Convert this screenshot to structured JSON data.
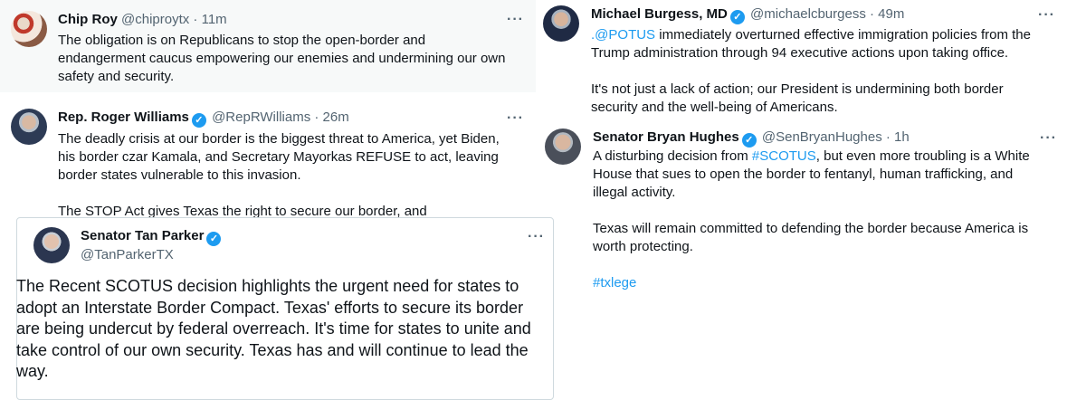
{
  "tweets": {
    "chip": {
      "name": "Chip Roy",
      "handle": "@chiproytx · 11m",
      "text": "The obligation is on Republicans to stop the open-border and\nendangerment caucus empowering our enemies and undermining our own\nsafety and security."
    },
    "roger": {
      "name": "Rep. Roger Williams",
      "handle": "@RepRWilliams · 26m",
      "text": "The deadly crisis at our border is the biggest threat to America, yet Biden,\nhis border czar Kamala, and Secretary Mayorkas REFUSE to act, leaving\nborder states vulnerable to this invasion.\n\nThe STOP Act gives Texas the right to secure our border, and"
    },
    "tan": {
      "name": "Senator Tan Parker",
      "handle": "@TanParkerTX",
      "text": "The Recent SCOTUS decision highlights the urgent need for states to adopt an Interstate Border Compact. Texas' efforts to secure its border are being undercut by federal overreach. It's time for states to unite and take control of our own security. Texas has and will continue to lead the way."
    },
    "burgess": {
      "name": "Michael Burgess, MD",
      "handle": "@michaelcburgess · 49m",
      "mention": ".@POTUS",
      "text_line1_rest": " immediately overturned effective immigration policies from the",
      "text_rest": "Trump administration through 94 executive actions upon taking office.\n\nIt's not just a lack of action; our President is undermining both border\nsecurity and the well-being of Americans."
    },
    "bryan": {
      "name": "Senator Bryan Hughes",
      "handle": "@SenBryanHughes · 1h",
      "text_prefix": "A disturbing decision from ",
      "hashtag1": "#SCOTUS",
      "text_line1_rest": ", but even more troubling is a White",
      "text_rest": "House that sues to open the border to fentanyl, human trafficking, and\nillegal activity.\n\nTexas will remain committed to defending the border because America is\nworth protecting.",
      "hashtag2": "#txlege"
    }
  },
  "icons": {
    "more": "···",
    "verified": "✓"
  },
  "colors": {
    "link": "#1d9bf0",
    "handle": "#536471",
    "highlight_bg": "#f7f9f9"
  }
}
